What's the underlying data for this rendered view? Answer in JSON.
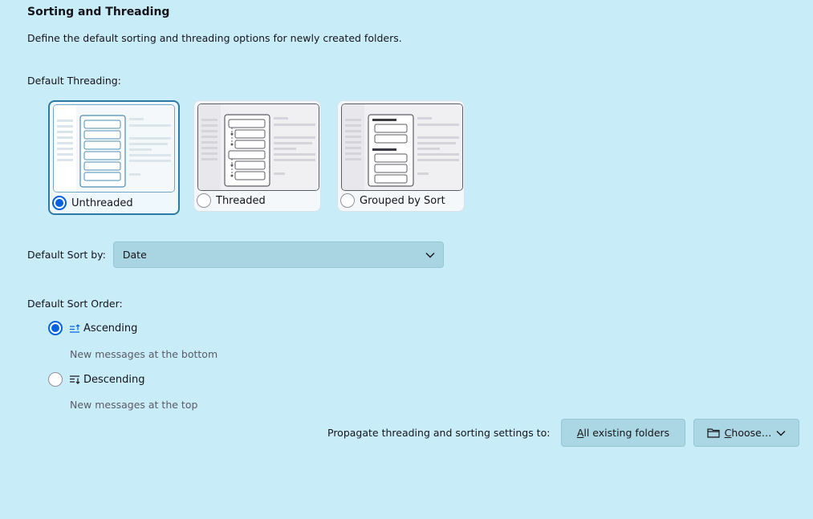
{
  "section": {
    "title": "Sorting and Threading",
    "description": "Define the default sorting and threading options for newly created folders."
  },
  "threading": {
    "label": "Default Threading:",
    "options": [
      {
        "label": "Unthreaded",
        "selected": true
      },
      {
        "label": "Threaded",
        "selected": false
      },
      {
        "label": "Grouped by Sort",
        "selected": false
      }
    ]
  },
  "sort_by": {
    "label": "Default Sort by:",
    "value": "Date"
  },
  "sort_order": {
    "label": "Default Sort Order:",
    "options": [
      {
        "label": "Ascending",
        "sub": "New messages at the bottom",
        "selected": true,
        "icon": "sort-ascending-icon"
      },
      {
        "label": "Descending",
        "sub": "New messages at the top",
        "selected": false,
        "icon": "sort-descending-icon"
      }
    ]
  },
  "propagate": {
    "label": "Propagate threading and sorting settings to:",
    "all_folders_mnemonic": "A",
    "all_folders_rest": "ll existing folders",
    "choose_mnemonic": "C",
    "choose_rest": "hoose…",
    "choose_icon": "folder-icon"
  },
  "colors": {
    "background": "#c8edf8",
    "accent": "#0061e0",
    "selected_border": "#2c7aa6"
  }
}
